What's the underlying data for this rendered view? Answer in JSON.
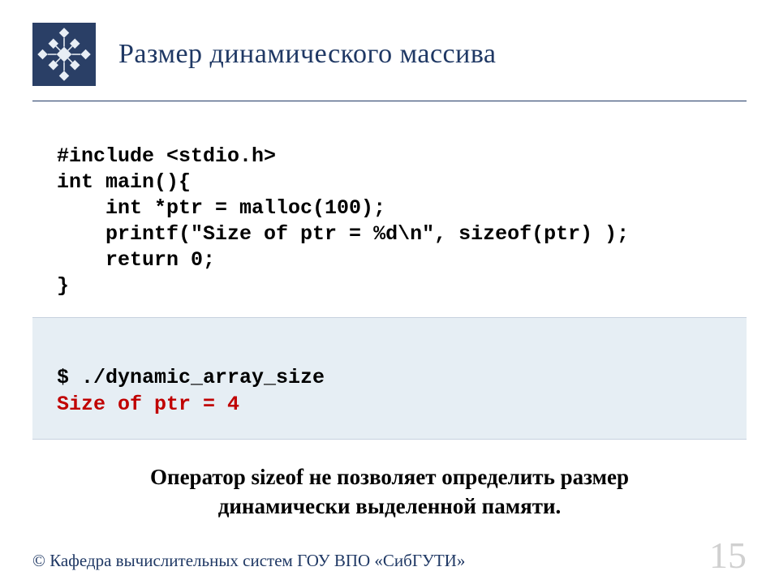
{
  "header": {
    "title": "Размер динамического массива"
  },
  "code": {
    "line1": "#include <stdio.h>",
    "line2": "int main(){",
    "line3": "    int *ptr = malloc(100);",
    "line4": "    printf(\"Size of ptr = %d\\n\", sizeof(ptr) );",
    "line5": "    return 0;",
    "line6": "}"
  },
  "output": {
    "command": "$ ./dynamic_array_size",
    "result": "Size of ptr = 4"
  },
  "note": {
    "line1": "Оператор sizeof не позволяет определить размер",
    "line2": "динамически выделенной памяти."
  },
  "footer": {
    "copyright": "© Кафедра вычислительных систем ГОУ ВПО «СибГУТИ»",
    "page": "15"
  }
}
